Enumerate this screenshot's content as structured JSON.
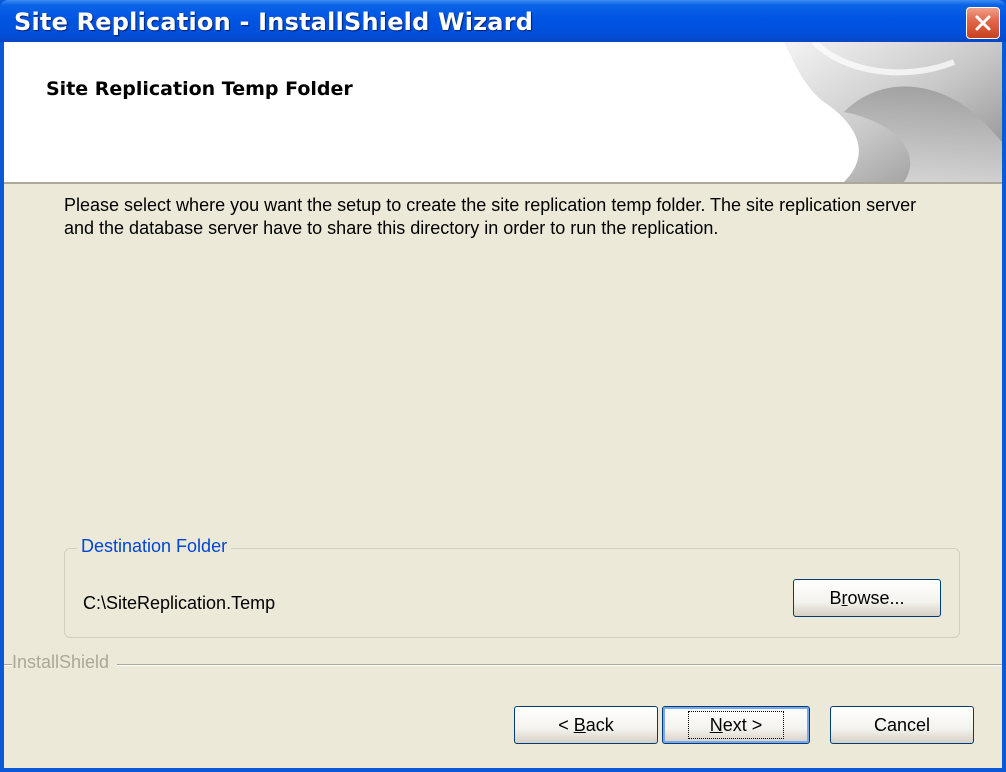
{
  "window": {
    "title": "Site Replication - InstallShield Wizard"
  },
  "header": {
    "title": "Site Replication Temp Folder"
  },
  "description": "Please select where you want the setup to create the site replication temp folder. The site replication server and the database server have to share this directory in order to run the replication.",
  "destination": {
    "legend": "Destination Folder",
    "path": "C:\\SiteReplication.Temp",
    "browse_label": "Browse..."
  },
  "footer": {
    "brand": "InstallShield",
    "back_label": "< Back",
    "next_label": "Next >",
    "cancel_label": "Cancel"
  },
  "icons": {
    "close": "close-icon",
    "header_graphic": "installshield-banner-icon"
  }
}
